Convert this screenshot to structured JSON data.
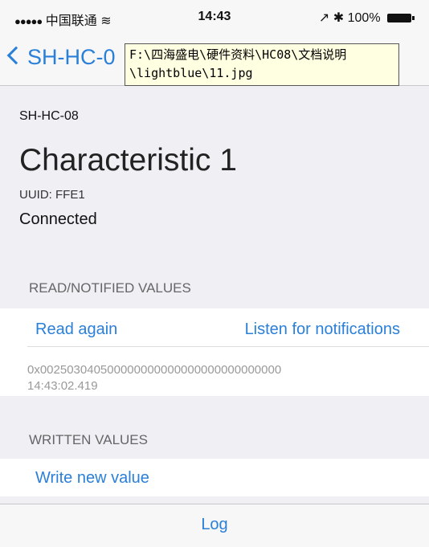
{
  "status_bar": {
    "signal": "●●●●●",
    "carrier": "中国联通",
    "wifi": "≋",
    "time": "14:43",
    "location": "↗",
    "bluetooth": "✱",
    "battery": "100%"
  },
  "nav": {
    "back_label": "SH-HC-0"
  },
  "tooltip": {
    "line1": "F:\\四海盛电\\硬件资料\\HC08\\文档说明",
    "line2": "\\lightblue\\11.jpg"
  },
  "device_name": "SH-HC-08",
  "characteristic": {
    "title": "Characteristic 1",
    "uuid": "UUID: FFE1",
    "status": "Connected"
  },
  "read_section": {
    "header": "READ/NOTIFIED VALUES",
    "read_again": "Read again",
    "listen": "Listen for notifications",
    "value": "0x002503040500000000000000000000000000",
    "timestamp": "14:43:02.419"
  },
  "written_section": {
    "header": "WRITTEN VALUES",
    "write_new": "Write new value"
  },
  "log": "Log"
}
